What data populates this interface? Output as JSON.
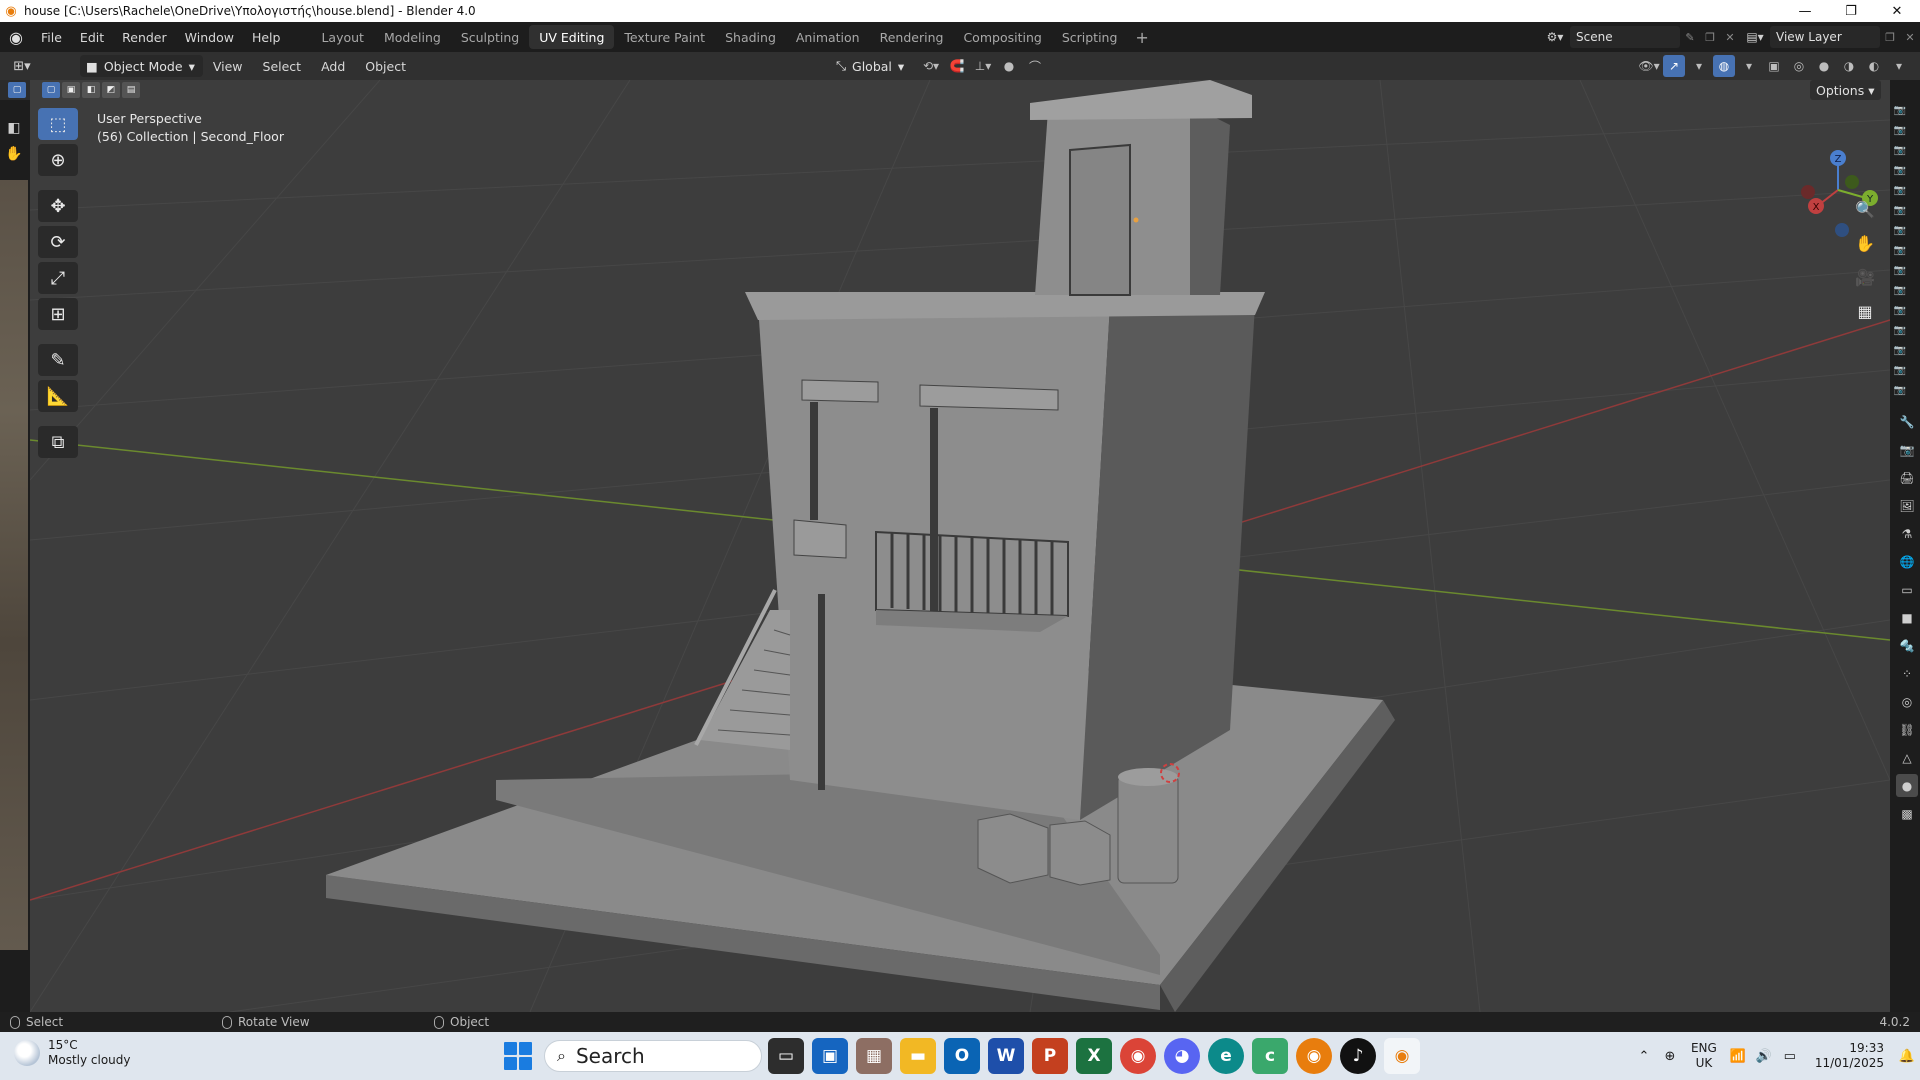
{
  "window": {
    "title": "house [C:\\Users\\Rachele\\OneDrive\\Υπολογιστής\\house.blend] - Blender 4.0",
    "controls": [
      "—",
      "❐",
      "✕"
    ]
  },
  "menu": [
    "File",
    "Edit",
    "Render",
    "Window",
    "Help"
  ],
  "workspaces": {
    "tabs": [
      "Layout",
      "Modeling",
      "Sculpting",
      "UV Editing",
      "Texture Paint",
      "Shading",
      "Animation",
      "Rendering",
      "Compositing",
      "Scripting"
    ],
    "active": "UV Editing",
    "add": "+"
  },
  "scene": {
    "label": "Scene",
    "view_layer": "View Layer"
  },
  "header": {
    "mode": "Object Mode",
    "menus": [
      "View",
      "Select",
      "Add",
      "Object"
    ],
    "transform_orientation": "Global"
  },
  "viewport": {
    "perspective": "User Perspective",
    "collection": "(56) Collection | Second_Floor",
    "options": "Options",
    "gizmo_axes": {
      "x": "X",
      "y": "Y",
      "z": "Z"
    },
    "colors": {
      "background": "#3d3d3d",
      "grid": "#4a4a4a",
      "x_axis": "#8f3a3a",
      "y_axis": "#6b8a2e",
      "mesh": "#8c8c8c"
    }
  },
  "tools": [
    "select-box",
    "cursor",
    "move",
    "rotate",
    "scale",
    "transform",
    "annotate",
    "measure",
    "add-cube"
  ],
  "status": {
    "select": "Select",
    "rotate": "Rotate View",
    "object": "Object",
    "version": "4.0.2"
  },
  "taskbar": {
    "weather_temp": "15°C",
    "weather_desc": "Mostly cloudy",
    "search": "Search",
    "lang_top": "ENG",
    "lang_bottom": "UK",
    "time": "19:33",
    "date": "11/01/2025",
    "accent": "#1a7ce0"
  }
}
